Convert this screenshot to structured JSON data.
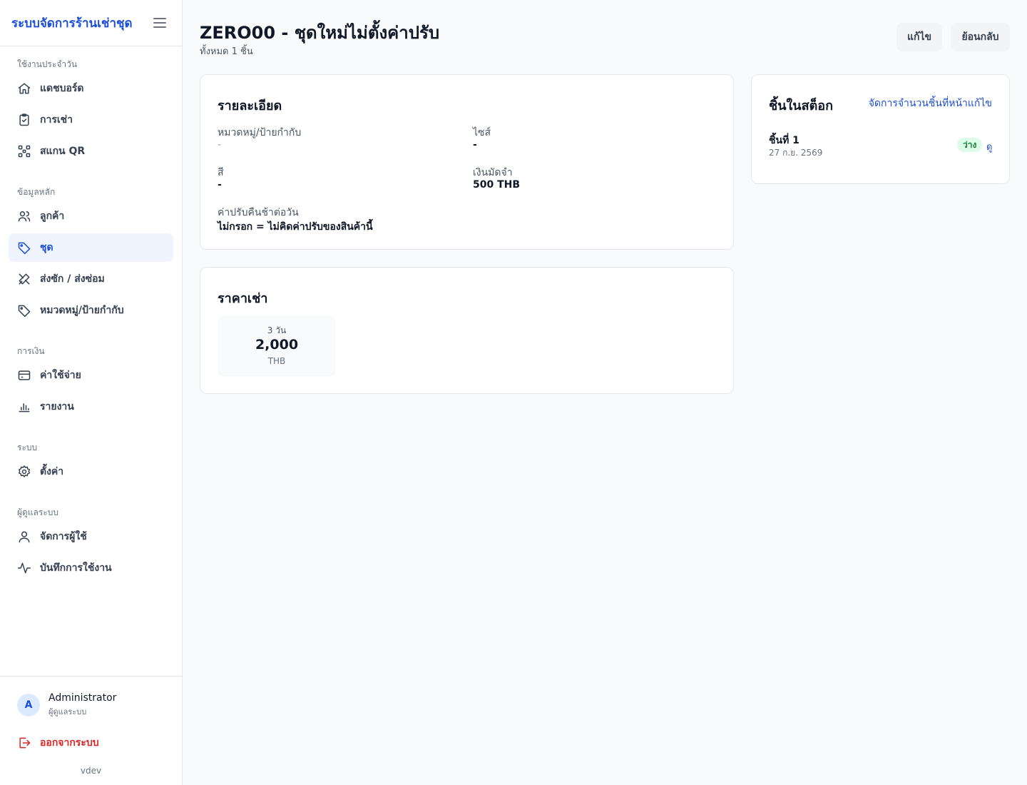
{
  "sidebar": {
    "brand": "ระบบจัดการร้านเช่าชุด",
    "sections": [
      {
        "label": "ใช้งานประจำวัน",
        "items": [
          {
            "label": "แดชบอร์ด",
            "icon": "home-icon"
          },
          {
            "label": "การเช่า",
            "icon": "clipboard-check-icon"
          },
          {
            "label": "สแกน QR",
            "icon": "qr-scan-icon"
          }
        ]
      },
      {
        "label": "ข้อมูลหลัก",
        "items": [
          {
            "label": "ลูกค้า",
            "icon": "users-icon"
          },
          {
            "label": "ชุด",
            "icon": "tag-icon",
            "active": true
          },
          {
            "label": "ส่งซัก / ส่งซ่อม",
            "icon": "tools-icon"
          },
          {
            "label": "หมวดหมู่/ป้ายกำกับ",
            "icon": "tag-outline-icon"
          }
        ]
      },
      {
        "label": "การเงิน",
        "items": [
          {
            "label": "ค่าใช้จ่าย",
            "icon": "credit-card-icon"
          },
          {
            "label": "รายงาน",
            "icon": "bar-chart-icon"
          }
        ]
      },
      {
        "label": "ระบบ",
        "items": [
          {
            "label": "ตั้งค่า",
            "icon": "gear-icon"
          }
        ]
      },
      {
        "label": "ผู้ดูแลระบบ",
        "items": [
          {
            "label": "จัดการผู้ใช้",
            "icon": "user-icon"
          },
          {
            "label": "บันทึกการใช้งาน",
            "icon": "activity-icon"
          }
        ]
      }
    ],
    "user": {
      "initial": "A",
      "name": "Administrator",
      "role": "ผู้ดูแลระบบ"
    },
    "logout_label": "ออกจากระบบ",
    "version": "vdev"
  },
  "header": {
    "title": "ZERO00 - ชุดใหม่ไม่ตั้งค่าปรับ",
    "subtitle": "ทั้งหมด 1 ชิ้น",
    "edit_label": "แก้ไข",
    "back_label": "ย้อนกลับ"
  },
  "details": {
    "title": "รายละเอียด",
    "category_label": "หมวดหมู่/ป้ายกำกับ",
    "category_value": "-",
    "size_label": "ไซส์",
    "size_value": "-",
    "color_label": "สี",
    "color_value": "-",
    "deposit_label": "เงินมัดจำ",
    "deposit_value": "500 THB",
    "late_fee_label": "ค่าปรับคืนช้าต่อวัน",
    "late_fee_value": "ไม่กรอก = ไม่คิดค่าปรับของสินค้านี้"
  },
  "pricing": {
    "title": "ราคาเช่า",
    "tiers": [
      {
        "days": "3 วัน",
        "amount": "2,000",
        "currency": "THB"
      }
    ]
  },
  "stock": {
    "title": "ชิ้นในสต็อก",
    "manage_link": "จัดการจำนวนชิ้นที่หน้าแก้ไข",
    "items": [
      {
        "name": "ชิ้นที่ 1",
        "date": "27 ก.ย. 2569",
        "status": "ว่าง",
        "view_label": "ดู"
      }
    ]
  },
  "colors": {
    "accent": "#1d4ed8",
    "active_bg": "#eff4ff",
    "danger": "#dc2626",
    "success_bg": "#dcfce7",
    "success_text": "#15803d"
  }
}
